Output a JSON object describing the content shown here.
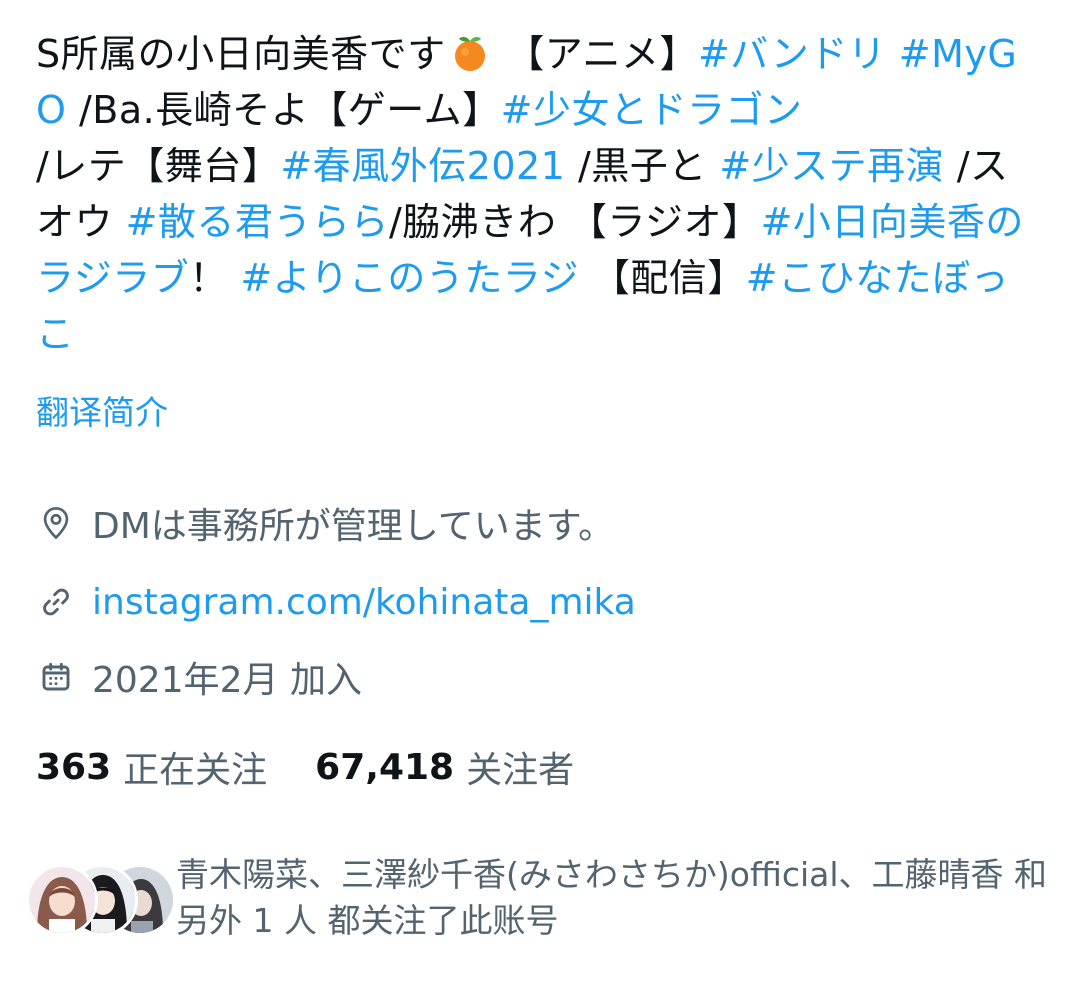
{
  "bio": {
    "segments": [
      {
        "text": "S所属の小日向美香です",
        "type": "text"
      },
      {
        "type": "emoji",
        "name": "tangerine-emoji"
      },
      {
        "text": " 【アニメ】",
        "type": "text"
      },
      {
        "text": "#バンドリ",
        "type": "tag"
      },
      {
        "text": " ",
        "type": "text"
      },
      {
        "text": "#MyGO",
        "type": "tag"
      },
      {
        "text": " /Ba.長崎そよ【ゲーム】",
        "type": "text"
      },
      {
        "text": "#少女とドラゴン",
        "type": "tag"
      },
      {
        "text": " /レテ【舞台】",
        "type": "text"
      },
      {
        "text": "#春風外伝2021",
        "type": "tag"
      },
      {
        "text": " /黒子と ",
        "type": "text"
      },
      {
        "text": "#少ステ再演",
        "type": "tag"
      },
      {
        "text": " /スオウ ",
        "type": "text"
      },
      {
        "text": "#散る君うらら",
        "type": "tag"
      },
      {
        "text": "/脇沸きわ 【ラジオ】",
        "type": "text"
      },
      {
        "text": "#小日向美香のラジラブ",
        "type": "tag"
      },
      {
        "text": "！ ",
        "type": "text"
      },
      {
        "text": "#よりこのうたラジ",
        "type": "tag"
      },
      {
        "text": " 【配信】",
        "type": "text"
      },
      {
        "text": "#こひなたぼっこ",
        "type": "tag"
      }
    ]
  },
  "translate_label": "翻译简介",
  "location": {
    "icon": "location-pin-icon",
    "text": "DMは事務所が管理しています。"
  },
  "website": {
    "icon": "link-icon",
    "text": "instagram.com/kohinata_mika"
  },
  "joined": {
    "icon": "calendar-icon",
    "text": "2021年2月 加入"
  },
  "follows": {
    "following_count": "363",
    "following_label": "正在关注",
    "followers_count": "67,418",
    "followers_label": "关注者"
  },
  "followed_by": {
    "text": "青木陽菜、三澤紗千香(みさわさちか)official、工藤晴香 和 另外 1 人 都关注了此账号"
  },
  "colors": {
    "accent": "#1d9bf0",
    "text": "#0f1419",
    "secondary": "#536471"
  }
}
